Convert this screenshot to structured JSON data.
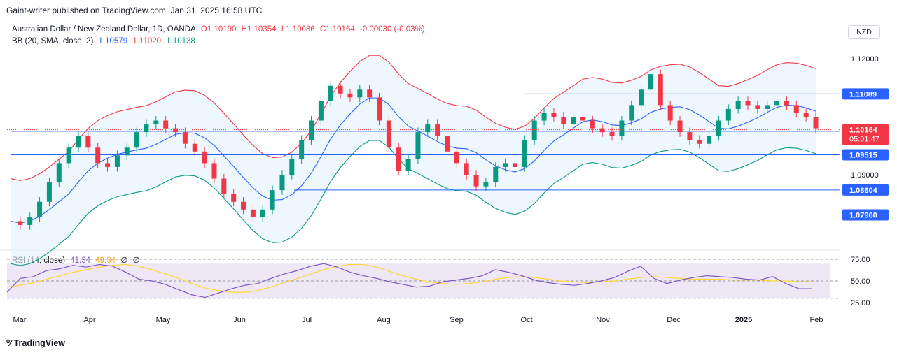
{
  "header": {
    "published": "Gaint-writer published on TradingView.com, Jan 31, 2025 16:58 UTC"
  },
  "legend": {
    "symbol": "Australian Dollar / New Zealand Dollar, 1D, OANDA",
    "o": "O1.10190",
    "h": "H1.10354",
    "l": "L1.10086",
    "c": "C1.10164",
    "chg": "-0.00030 (-0.03%)",
    "bb_label": "BB (20, SMA, close, 2)",
    "bb_basis": "1.10579",
    "bb_upper": "1.11020",
    "bb_lower": "1.10138",
    "rsi_label": "RSI (14, close)",
    "rsi_value": "41.34",
    "rsi_ma": "49.34",
    "rsi_extra1": "∅",
    "rsi_extra2": "∅"
  },
  "currency_button": "NZD",
  "footer": {
    "logo": "TradingView"
  },
  "colors": {
    "up": "#089981",
    "down": "#f23645",
    "bb_upper": "#f23645",
    "bb_lower": "#089981",
    "bb_basis": "#2962ff",
    "bb_fill": "#e3f2fd",
    "level": "#2962ff",
    "rsi": "#7e57c2",
    "rsi_ma": "#fdd835",
    "rsi_band": "#ede7f6"
  },
  "chart_data": {
    "type": "candlestick",
    "price_ticks": [
      "1.12000",
      "1.09000"
    ],
    "rsi_ticks": [
      "75.00",
      "50.00",
      "25.00"
    ],
    "x_labels": [
      "Mar",
      "Apr",
      "May",
      "Jun",
      "Jul",
      "Aug",
      "Sep",
      "Oct",
      "Nov",
      "Dec",
      "2025",
      "Feb"
    ],
    "levels": [
      {
        "label": "1.11089",
        "value": 1.11089
      },
      {
        "label": "1.10123",
        "value": 1.10123
      },
      {
        "label": "1.09515",
        "value": 1.09515
      },
      {
        "label": "1.08604",
        "value": 1.08604
      },
      {
        "label": "1.07960",
        "value": 1.0796
      }
    ],
    "last_price": {
      "label": "1.10164",
      "countdown": "05:01:47",
      "value": 1.10164
    },
    "close_path": [
      1.078,
      1.077,
      1.079,
      1.083,
      1.088,
      1.093,
      1.097,
      1.1,
      1.097,
      1.093,
      1.092,
      1.095,
      1.097,
      1.101,
      1.103,
      1.104,
      1.102,
      1.101,
      1.098,
      1.096,
      1.093,
      1.089,
      1.085,
      1.083,
      1.081,
      1.079,
      1.081,
      1.086,
      1.09,
      1.094,
      1.099,
      1.104,
      1.109,
      1.113,
      1.111,
      1.11,
      1.112,
      1.11,
      1.104,
      1.097,
      1.091,
      1.094,
      1.101,
      1.103,
      1.1,
      1.096,
      1.093,
      1.09,
      1.087,
      1.088,
      1.092,
      1.093,
      1.092,
      1.099,
      1.104,
      1.106,
      1.105,
      1.103,
      1.105,
      1.104,
      1.102,
      1.101,
      1.1,
      1.104,
      1.108,
      1.112,
      1.116,
      1.108,
      1.104,
      1.101,
      1.099,
      1.098,
      1.1,
      1.104,
      1.107,
      1.109,
      1.108,
      1.107,
      1.108,
      1.109,
      1.108,
      1.106,
      1.105,
      1.102
    ],
    "rsi_path": [
      37,
      53,
      55,
      62,
      64,
      68,
      66,
      69,
      67,
      60,
      52,
      50,
      46,
      40,
      34,
      31,
      36,
      41,
      45,
      47,
      53,
      58,
      62,
      67,
      70,
      66,
      60,
      56,
      53,
      49,
      46,
      43,
      44,
      49,
      51,
      53,
      56,
      63,
      60,
      56,
      51,
      48,
      46,
      45,
      47,
      50,
      54,
      61,
      67,
      53,
      47,
      51,
      54,
      56,
      55,
      54,
      52,
      51,
      55,
      47,
      41,
      41
    ],
    "rsi_ma_path": [
      43,
      45,
      48,
      52,
      56,
      60,
      63,
      66,
      68,
      69,
      67,
      63,
      58,
      53,
      47,
      42,
      39,
      37,
      37,
      39,
      43,
      48,
      53,
      58,
      63,
      67,
      69,
      69,
      66,
      61,
      56,
      52,
      49,
      47,
      46,
      47,
      49,
      52,
      54,
      55,
      54,
      52,
      50,
      49,
      48,
      49,
      50,
      52,
      54,
      55,
      54,
      53,
      52,
      52,
      52,
      51,
      51,
      51,
      50,
      50,
      49,
      49
    ]
  }
}
